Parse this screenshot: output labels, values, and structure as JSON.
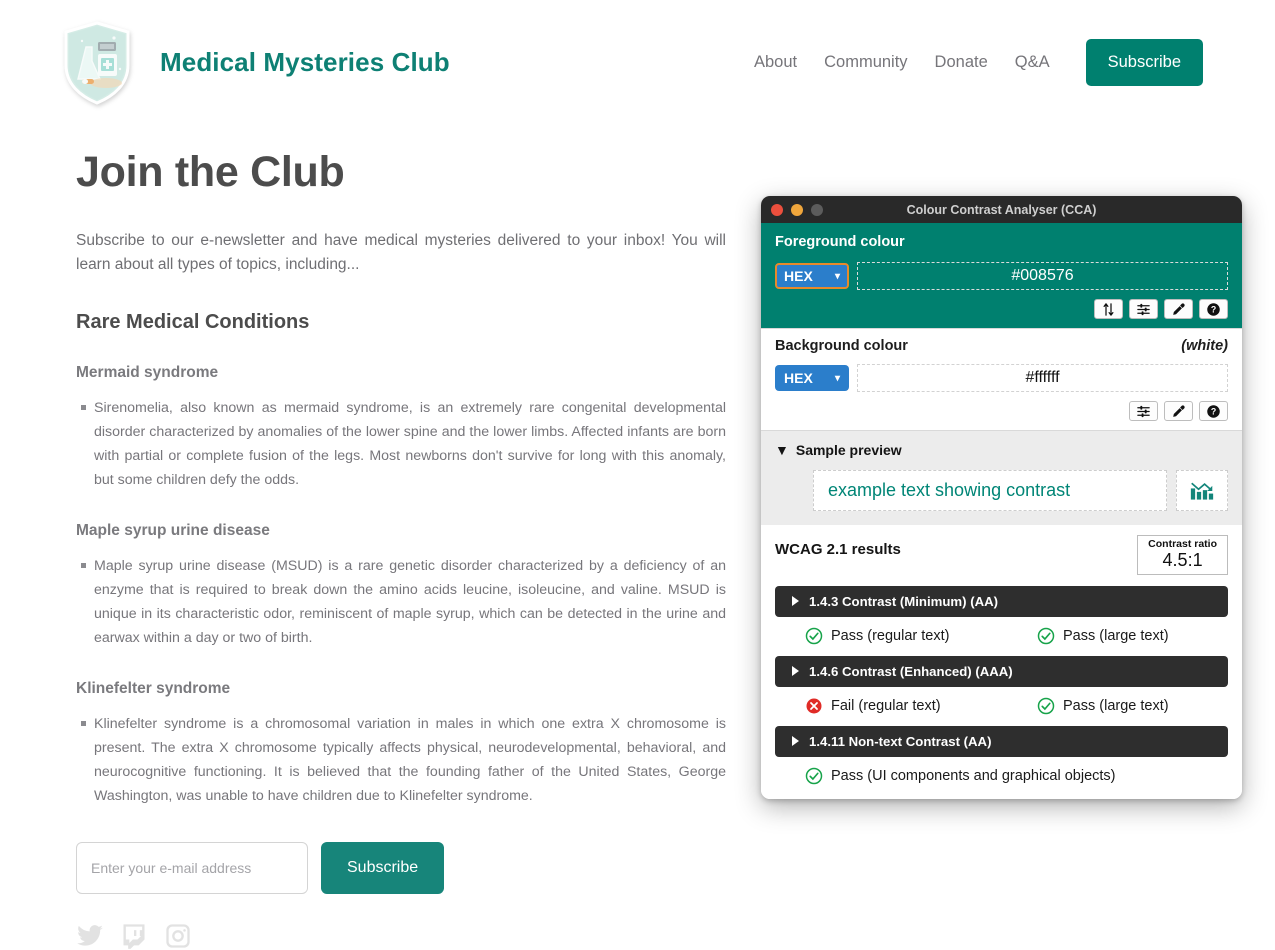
{
  "site": {
    "brand_title": "Medical Mysteries Club",
    "logo_icon": "medical-shield-logo",
    "nav": [
      {
        "label": "About"
      },
      {
        "label": "Community"
      },
      {
        "label": "Donate"
      },
      {
        "label": "Q&A"
      }
    ],
    "nav_cta": "Subscribe",
    "accent_color": "#0e8074",
    "button_color": "#00806f"
  },
  "main": {
    "page_title": "Join the Club",
    "intro": "Subscribe to our e-newsletter and have medical mysteries delivered to your inbox! You will learn about all types of topics, including...",
    "section_title": "Rare Medical Conditions",
    "conditions": [
      {
        "name": "Mermaid syndrome",
        "body": "Sirenomelia, also known as mermaid syndrome, is an extremely rare congenital developmental disorder characterized by anomalies of the lower spine and the lower limbs. Affected infants are born with partial or complete fusion of the legs. Most newborns don't survive for long with this anomaly, but some children defy the odds."
      },
      {
        "name": "Maple syrup urine disease",
        "body": "Maple syrup urine disease (MSUD) is a rare genetic disorder characterized by a deficiency of an enzyme that is required to break down the amino acids leucine, isoleucine, and valine. MSUD is unique in its characteristic odor, reminiscent of maple syrup, which can be detected in the urine and earwax within a day or two of birth."
      },
      {
        "name": "Klinefelter syndrome",
        "body": "Klinefelter syndrome is a chromosomal variation in males in which one extra X chromosome is present. The extra X chromosome typically affects physical, neurodevelopmental, behavioral, and neurocognitive functioning. It is believed that the founding father of the United States, George Washington, was unable to have children due to Klinefelter syndrome."
      }
    ],
    "form": {
      "email_placeholder": "Enter your e-mail address",
      "email_value": "",
      "submit_label": "Subscribe"
    },
    "social": [
      {
        "icon": "twitter-icon",
        "name": "Twitter"
      },
      {
        "icon": "twitch-icon",
        "name": "Twitch"
      },
      {
        "icon": "instagram-icon",
        "name": "Instagram"
      }
    ]
  },
  "cca": {
    "window_title": "Colour Contrast Analyser (CCA)",
    "traffic_lights": [
      "close",
      "minimize",
      "zoom"
    ],
    "foreground": {
      "label": "Foreground colour",
      "format": "HEX",
      "value": "#008576",
      "panel_color": "#00806f",
      "tools": [
        "swap-colours-icon",
        "sliders-icon",
        "eyedropper-icon",
        "help-icon"
      ]
    },
    "background": {
      "label": "Background colour",
      "note": "(white)",
      "format": "HEX",
      "value": "#ffffff",
      "tools": [
        "sliders-icon",
        "eyedropper-icon",
        "help-icon"
      ]
    },
    "preview": {
      "disclosure_label": "Sample preview",
      "expanded": true,
      "sample_text": "example text showing contrast",
      "sample_graphic": "bar-chart-icon"
    },
    "results": {
      "title": "WCAG 2.1 results",
      "ratio_label": "Contrast ratio",
      "ratio_value": "4.5:1",
      "criteria": [
        {
          "label": "1.4.3 Contrast (Minimum) (AA)",
          "results": [
            {
              "status": "pass",
              "text": "Pass (regular text)"
            },
            {
              "status": "pass",
              "text": "Pass (large text)"
            }
          ]
        },
        {
          "label": "1.4.6 Contrast (Enhanced) (AAA)",
          "results": [
            {
              "status": "fail",
              "text": "Fail (regular text)"
            },
            {
              "status": "pass",
              "text": "Pass (large text)"
            }
          ]
        },
        {
          "label": "1.4.11 Non-text Contrast (AA)",
          "results": [
            {
              "status": "pass",
              "text": "Pass (UI components and graphical objects)"
            }
          ]
        }
      ]
    }
  }
}
